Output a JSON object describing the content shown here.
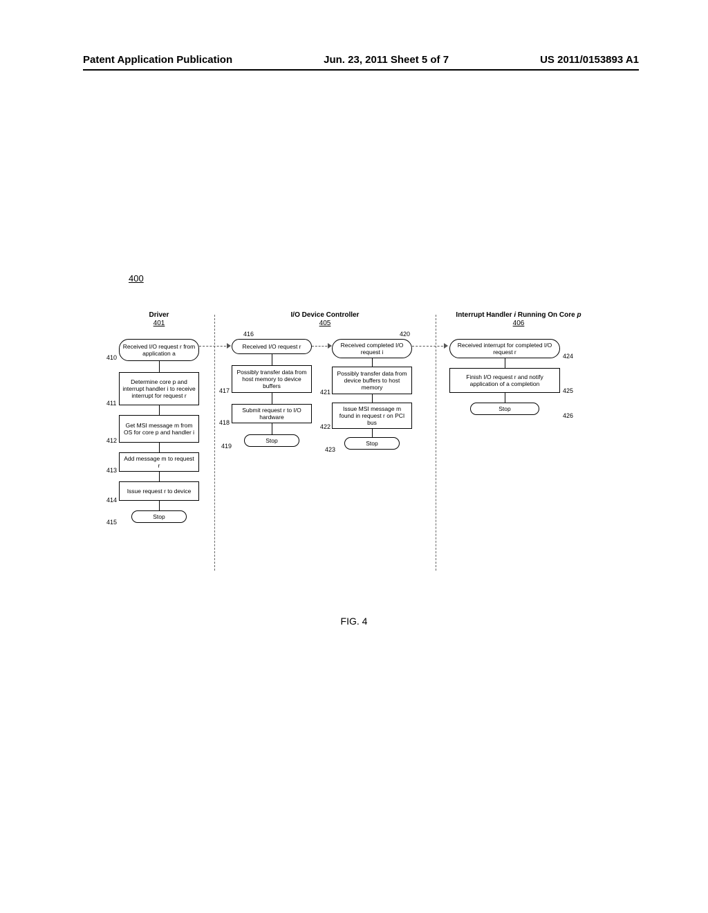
{
  "header": {
    "left": "Patent Application Publication",
    "center": "Jun. 23, 2011  Sheet 5 of 7",
    "right": "US 2011/0153893 A1"
  },
  "figure_ref": "400",
  "lanes": {
    "driver": {
      "title": "Driver",
      "num": "401"
    },
    "controller": {
      "title": "I/O Device Controller",
      "num": "405"
    },
    "handler": {
      "title_a": "Interrupt Handler",
      "title_b": "Running On Core",
      "var_i": "i",
      "var_p": "p",
      "num": "406"
    }
  },
  "nodes": {
    "n410": "Received I/O request r from application a",
    "n411": "Determine core p and interrupt handler i to receive interrupt for request r",
    "n412": "Get MSI message m from OS for core p and handler i",
    "n413": "Add message m to request r",
    "n414": "Issue request r to device",
    "n415": "Stop",
    "n416": "Received I/O request r",
    "n417": "Possibly transfer data from host memory to device buffers",
    "n418": "Submit request r to I/O hardware",
    "n419": "Stop",
    "n420": "Received completed I/O request i",
    "n421": "Possibly transfer data from device buffers to host memory",
    "n422": "Issue MSI message m found in request r on PCI bus",
    "n423": "Stop",
    "n424": "Received interrupt for completed I/O request r",
    "n425": "Finish I/O request r and notify application of a completion",
    "n426": "Stop"
  },
  "refs": {
    "r410": "410",
    "r411": "411",
    "r412": "412",
    "r413": "413",
    "r414": "414",
    "r415": "415",
    "r416": "416",
    "r417": "417",
    "r418": "418",
    "r419": "419",
    "r420": "420",
    "r421": "421",
    "r422": "422",
    "r423": "423",
    "r424": "424",
    "r425": "425",
    "r426": "426"
  },
  "caption": "FIG. 4"
}
